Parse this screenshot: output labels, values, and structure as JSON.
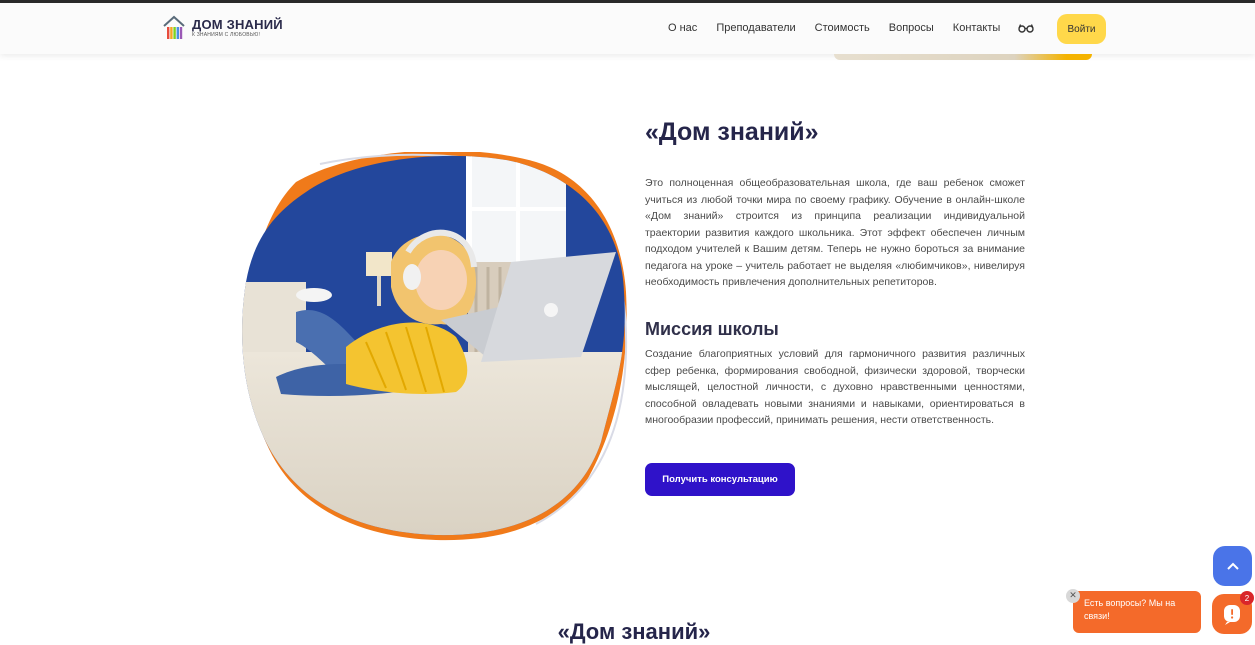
{
  "logo": {
    "title": "ДОМ ЗНАНИЙ",
    "subtitle": "К ЗНАНИЯМ С ЛЮБОВЬЮ!"
  },
  "nav": {
    "items": [
      "О нас",
      "Преподаватели",
      "Стоимость",
      "Вопросы",
      "Контакты"
    ],
    "accessibility_icon": "glasses-icon",
    "login_label": "Войти"
  },
  "about": {
    "title": "«Дом знаний»",
    "description": "Это полноценная общеобразовательная школа, где ваш ребенок сможет учиться из любой точки мира по своему графику. Обучение в онлайн-школе «Дом знаний» строится из принципа реализации индивидуальной траектории развития каждого школьника. Этот эффект обеспечен личным подходом учителей к Вашим детям. Теперь не нужно бороться за внимание педагога на уроке – учитель работает не выделяя «любимчиков», нивелируя необходимость привлечения дополнительных репетиторов.",
    "mission_title": "Миссия школы",
    "mission_text": "Создание благоприятных условий для гармоничного развития различных сфер ребенка, формирования свободной, физически здоровой, творчески мыслящей, целостной личности, с духовно нравственными ценностями, способной овладевать новыми знаниями и навыками, ориентироваться в многообразии профессий, принимать решения, нести ответственность.",
    "cta_label": "Получить консультацию"
  },
  "next_section": {
    "title": "«Дом знаний»"
  },
  "widgets": {
    "chat_prompt": "Есть вопросы? Мы на связи!",
    "chat_close": "✕",
    "chat_badge": "2",
    "scroll_top_icon": "chevron-up-icon",
    "chat_icon": "chat-icon"
  },
  "colors": {
    "accent_purple": "#2f12c9",
    "login_yellow": "#ffd84a",
    "chat_orange": "#f46a2a",
    "scroll_blue": "#4a74e8",
    "blob_orange": "#f07a1a"
  }
}
